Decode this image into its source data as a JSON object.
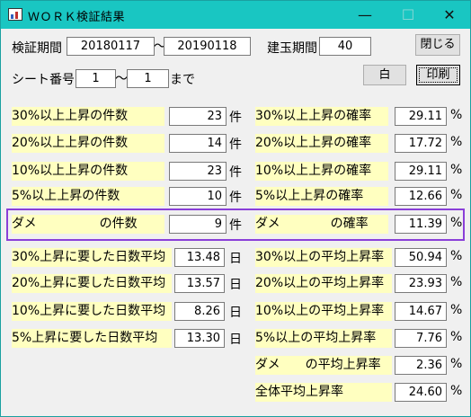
{
  "window": {
    "title": "ＷＯＲＫ検証結果",
    "minimize": "—",
    "maximize": "☐",
    "close": "✕"
  },
  "header": {
    "period_label": "検証期間",
    "period_start": "20180117",
    "tilde": "～",
    "period_end": "20190118",
    "position_label": "建玉期間",
    "position_value": "40",
    "close_button": "閉じる",
    "sheet_label": "シート番号",
    "sheet_start": "1",
    "sheet_tilde": "～",
    "sheet_end": "1",
    "sheet_suffix": "まで",
    "white_button": "白",
    "print_button": "印刷"
  },
  "left_rows": [
    {
      "label": "30%以上上昇の件数",
      "value": "23",
      "unit": "件"
    },
    {
      "label": "20%以上上昇の件数",
      "value": "14",
      "unit": "件"
    },
    {
      "label": "10%以上上昇の件数",
      "value": "23",
      "unit": "件"
    },
    {
      "label": " 5%以上上昇の件数",
      "value": "10",
      "unit": "件"
    },
    {
      "label": "ダメ　　　　　の件数",
      "value": "9",
      "unit": "件"
    },
    {
      "label": "30%上昇に要した日数平均",
      "value": "13.48",
      "unit": "日"
    },
    {
      "label": "20%上昇に要した日数平均",
      "value": "13.57",
      "unit": "日"
    },
    {
      "label": "10%上昇に要した日数平均",
      "value": "8.26",
      "unit": "日"
    },
    {
      "label": " 5%上昇に要した日数平均",
      "value": "13.30",
      "unit": "日"
    }
  ],
  "right_rows": [
    {
      "label": "30%以上上昇の確率",
      "value": "29.11",
      "unit": "%"
    },
    {
      "label": "20%以上上昇の確率",
      "value": "17.72",
      "unit": "%"
    },
    {
      "label": "10%以上上昇の確率",
      "value": "29.11",
      "unit": "%"
    },
    {
      "label": " 5%以上上昇の確率",
      "value": "12.66",
      "unit": "%"
    },
    {
      "label": "ダメ　　　　の確率",
      "value": "11.39",
      "unit": "%"
    },
    {
      "label": "30%以上の平均上昇率",
      "value": "50.94",
      "unit": "%"
    },
    {
      "label": "20%以上の平均上昇率",
      "value": "23.93",
      "unit": "%"
    },
    {
      "label": "10%以上の平均上昇率",
      "value": "14.67",
      "unit": "%"
    },
    {
      "label": " 5%以上の平均上昇率",
      "value": "7.76",
      "unit": "%"
    },
    {
      "label": "ダメ　　の平均上昇率",
      "value": "2.36",
      "unit": "%"
    },
    {
      "label": "全体平均上昇率",
      "value": "24.60",
      "unit": "%"
    }
  ],
  "colors": {
    "titlebar": "#19c6c2",
    "label_bg": "#ffffc0",
    "highlight_border": "#8a3fd8"
  }
}
